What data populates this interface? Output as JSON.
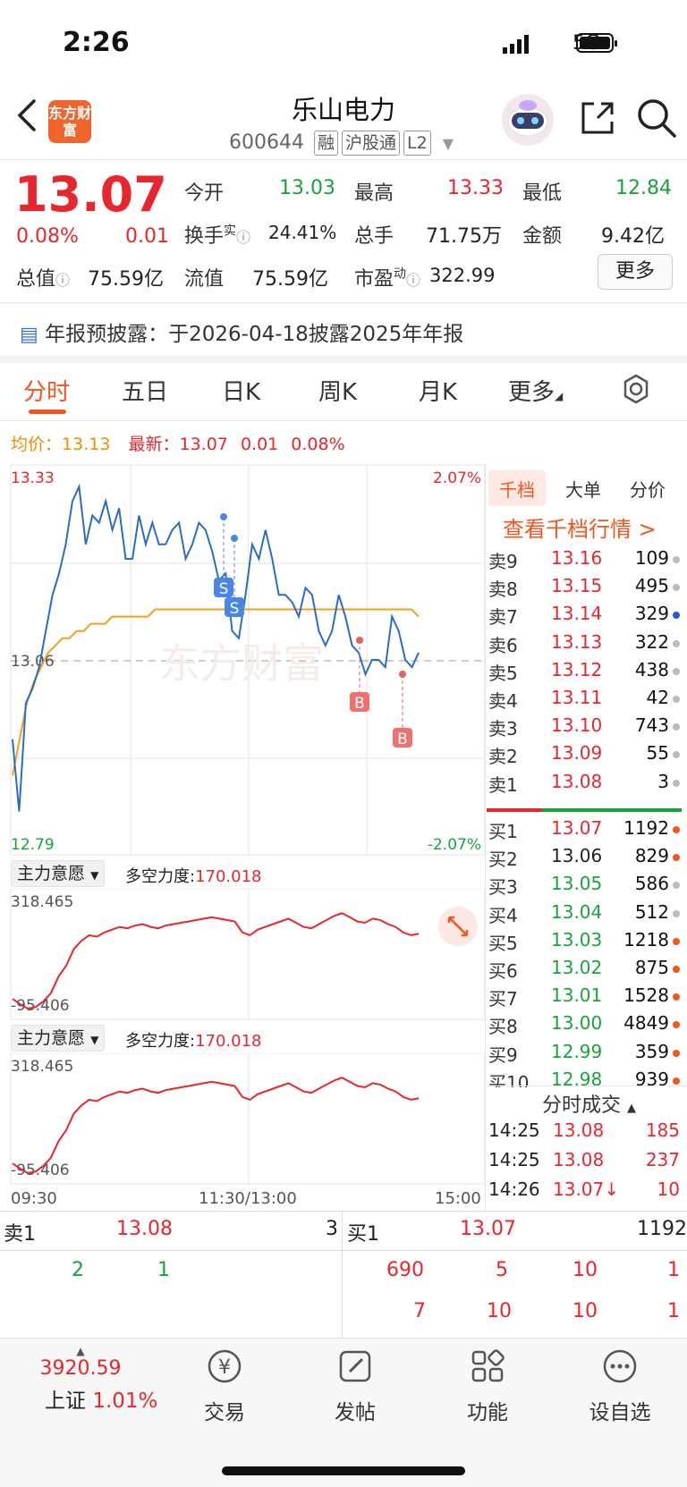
{
  "status_bar": {
    "time": "2:26",
    "network": "5G"
  },
  "header": {
    "logo_text": "东方财富",
    "title": "乐山电力",
    "code": "600644",
    "tags": [
      "融",
      "沪股通",
      "L2"
    ]
  },
  "quote": {
    "price": "13.07",
    "change_pct": "0.08%",
    "change": "0.01",
    "fields": {
      "open_label": "今开",
      "open": "13.03",
      "high_label": "最高",
      "high": "13.33",
      "low_label": "最低",
      "low": "12.84",
      "turnover_label": "换手",
      "turnover_sup": "实",
      "turnover": "24.41%",
      "volume_label": "总手",
      "volume": "71.75万",
      "amount_label": "金额",
      "amount": "9.42亿",
      "mktcap_label": "总值",
      "mktcap": "75.59亿",
      "float_label": "流值",
      "float": "75.59亿",
      "pe_label": "市盈",
      "pe_sup": "动",
      "pe": "322.99"
    },
    "more_button": "更多"
  },
  "notice": "年报预披露：于2026-04-18披露2025年年报",
  "tabs": [
    "分时",
    "五日",
    "日K",
    "周K",
    "月K",
    "更多"
  ],
  "subinfo": {
    "avg_label": "均价：",
    "avg": "13.13",
    "latest_label": "最新：",
    "latest": "13.07",
    "change": "0.01",
    "pct": "0.08%"
  },
  "chart_data": {
    "type": "line",
    "price_axis": {
      "max": "13.33",
      "mid": "13.06",
      "min": "12.79",
      "pct_max": "2.07%",
      "pct_min": "-2.07%"
    },
    "time_labels": [
      "09:30",
      "11:30/13:00",
      "15:00"
    ],
    "watermark": "东方财富",
    "markers": [
      "S",
      "S",
      "B",
      "B"
    ],
    "price_series": [
      12.95,
      12.85,
      13.0,
      13.02,
      13.05,
      13.1,
      13.15,
      13.18,
      13.22,
      13.28,
      13.3,
      13.22,
      13.26,
      13.25,
      13.28,
      13.24,
      13.27,
      13.2,
      13.2,
      13.26,
      13.22,
      13.25,
      13.22,
      13.22,
      13.24,
      13.25,
      13.2,
      13.22,
      13.25,
      13.24,
      13.21,
      13.17,
      13.18,
      13.1,
      13.09,
      13.15,
      13.22,
      13.2,
      13.24,
      13.2,
      13.15,
      13.15,
      13.14,
      13.12,
      13.16,
      13.15,
      13.1,
      13.08,
      13.1,
      13.15,
      13.12,
      13.08,
      13.07,
      13.04,
      13.06,
      13.06,
      13.05,
      13.12,
      13.1,
      13.06,
      13.05,
      13.07
    ],
    "avg_series": [
      12.9,
      12.95,
      13.0,
      13.03,
      13.05,
      13.07,
      13.08,
      13.09,
      13.09,
      13.1,
      13.1,
      13.11,
      13.11,
      13.11,
      13.12,
      13.12,
      13.12,
      13.12,
      13.12,
      13.12,
      13.13,
      13.13,
      13.13,
      13.13,
      13.13,
      13.13,
      13.13,
      13.13,
      13.13,
      13.13,
      13.13,
      13.13,
      13.13,
      13.13,
      13.13,
      13.13,
      13.13,
      13.13,
      13.13,
      13.13,
      13.13,
      13.13,
      13.13,
      13.13,
      13.13,
      13.13,
      13.13,
      13.13,
      13.13,
      13.13,
      13.13,
      13.13,
      13.13,
      13.13,
      13.13,
      13.13,
      13.13,
      13.12
    ],
    "indicator_label": "主力意愿",
    "indicator_value_label": "多空力度:",
    "indicator_value": "170.018",
    "indicator_axis": {
      "max": "318.465",
      "min": "-95.406"
    },
    "indicator_series": [
      -60,
      -80,
      -95,
      -90,
      -70,
      -40,
      20,
      60,
      120,
      150,
      170,
      165,
      180,
      190,
      200,
      195,
      205,
      210,
      200,
      195,
      205,
      210,
      215,
      220,
      225,
      230,
      235,
      230,
      225,
      220,
      180,
      170,
      190,
      200,
      210,
      220,
      230,
      215,
      200,
      195,
      210,
      225,
      240,
      250,
      235,
      220,
      215,
      230,
      225,
      210,
      200,
      180,
      170,
      175
    ]
  },
  "orderbook": {
    "tabs": [
      "千档",
      "大单",
      "分价"
    ],
    "link": "查看千档行情 >",
    "asks": [
      {
        "label": "卖9",
        "price": "13.16",
        "vol": "109",
        "dot": "#bbbbbb"
      },
      {
        "label": "卖8",
        "price": "13.15",
        "vol": "495",
        "dot": "#bbbbbb"
      },
      {
        "label": "卖7",
        "price": "13.14",
        "vol": "329",
        "dot": "#1e5bd8"
      },
      {
        "label": "卖6",
        "price": "13.13",
        "vol": "322",
        "dot": "#bbbbbb"
      },
      {
        "label": "卖5",
        "price": "13.12",
        "vol": "438",
        "dot": "#bbbbbb"
      },
      {
        "label": "卖4",
        "price": "13.11",
        "vol": "42",
        "dot": "#bbbbbb"
      },
      {
        "label": "卖3",
        "price": "13.10",
        "vol": "743",
        "dot": "#bbbbbb"
      },
      {
        "label": "卖2",
        "price": "13.09",
        "vol": "55",
        "dot": "#bbbbbb"
      },
      {
        "label": "卖1",
        "price": "13.08",
        "vol": "3",
        "dot": "#bbbbbb"
      }
    ],
    "bids": [
      {
        "label": "买1",
        "price": "13.07",
        "vol": "1192",
        "dot": "#f0571e",
        "color": "red"
      },
      {
        "label": "买2",
        "price": "13.06",
        "vol": "829",
        "dot": "#f0571e",
        "color": "dark"
      },
      {
        "label": "买3",
        "price": "13.05",
        "vol": "586",
        "dot": "#bbbbbb",
        "color": "green"
      },
      {
        "label": "买4",
        "price": "13.04",
        "vol": "512",
        "dot": "#bbbbbb",
        "color": "green"
      },
      {
        "label": "买5",
        "price": "13.03",
        "vol": "1218",
        "dot": "#f0571e",
        "color": "green"
      },
      {
        "label": "买6",
        "price": "13.02",
        "vol": "875",
        "dot": "#f0571e",
        "color": "green"
      },
      {
        "label": "买7",
        "price": "13.01",
        "vol": "1528",
        "dot": "#f0571e",
        "color": "green"
      },
      {
        "label": "买8",
        "price": "13.00",
        "vol": "4849",
        "dot": "#f0571e",
        "color": "green"
      },
      {
        "label": "买9",
        "price": "12.99",
        "vol": "359",
        "dot": "#f0571e",
        "color": "green"
      },
      {
        "label": "买10",
        "price": "12.98",
        "vol": "939",
        "dot": "#f0571e",
        "color": "green"
      }
    ],
    "ticks_title": "分时成交",
    "ticks": [
      {
        "time": "14:25",
        "price": "13.08",
        "vol": "185"
      },
      {
        "time": "14:25",
        "price": "13.08",
        "vol": "237"
      },
      {
        "time": "14:26",
        "price": "13.07↓",
        "vol": "10"
      }
    ]
  },
  "level_panel": {
    "sell_label": "卖1",
    "sell_price": "13.08",
    "sell_vol": "3",
    "buy_label": "买1",
    "buy_price": "13.07",
    "buy_vol": "1192",
    "sell_queue": [
      "2",
      "1"
    ],
    "buy_queue": [
      [
        "690",
        "5",
        "10",
        "1"
      ],
      [
        "7",
        "10",
        "10",
        "1"
      ]
    ]
  },
  "bottom_nav": {
    "index_value": "3920.59",
    "index_name": "上证",
    "index_pct": "1.01%",
    "items": [
      "交易",
      "发帖",
      "功能",
      "设自选"
    ]
  }
}
